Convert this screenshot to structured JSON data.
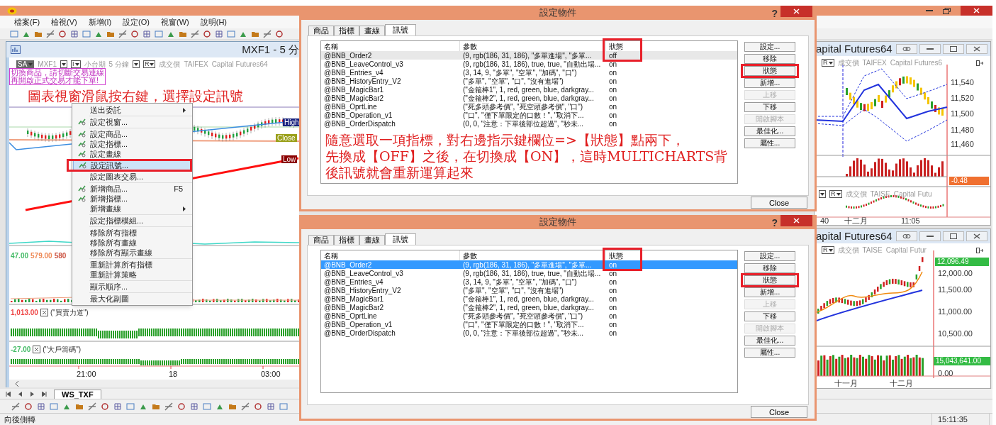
{
  "main_window": {
    "menu": [
      "檔案(F)",
      "檢視(V)",
      "新增(I)",
      "設定(O)",
      "視窗(W)",
      "說明(H)"
    ],
    "sheet_tab": "WS_TXF",
    "status_text": "向後側轉",
    "clock": "15:11:35"
  },
  "chart_window": {
    "title": "MXF1 - 5 分",
    "info": [
      {
        "kind": "badge",
        "text": "SA"
      },
      {
        "kind": "text",
        "text": "MXF1"
      },
      {
        "kind": "dropdown"
      },
      {
        "kind": "dropdown",
        "text": "I"
      },
      {
        "kind": "text",
        "text": "小台期"
      },
      {
        "kind": "text",
        "text": "5 分鐘"
      },
      {
        "kind": "dropdown"
      },
      {
        "kind": "dropdown",
        "text": "R"
      },
      {
        "kind": "text",
        "text": "成交價"
      },
      {
        "kind": "text",
        "text": "TAIFEX"
      },
      {
        "kind": "text",
        "text": "Capital Futures64"
      }
    ],
    "warning": [
      "切換商品，請切斷交易連線",
      "再開啟正式交易才能下單!"
    ],
    "annotation": "圖表視窗滑鼠按右鍵，選擇設定訊號",
    "price_tags": [
      {
        "label": "High",
        "color": "#1a237e"
      },
      {
        "label": "Close",
        "color": "#9aa01a"
      },
      {
        "label": "Low",
        "color": "#8b0000"
      }
    ],
    "panes": [
      {
        "values": [
          {
            "text": "47.00",
            "color": "#44bb66"
          },
          {
            "text": "579.00",
            "color": "#ee8855"
          },
          {
            "text": "580",
            "color": "#cc5544"
          }
        ]
      },
      {
        "values": [
          {
            "text": "1,013.00",
            "color": "#ee4444"
          }
        ],
        "name": "(\"買賣力道\")"
      },
      {
        "values": [
          {
            "text": "-27.00",
            "color": "#44bb66"
          }
        ],
        "name": "(\"大戶籌碼\")"
      }
    ],
    "time_labels": [
      "21:00",
      "18",
      "03:00"
    ]
  },
  "context_menu": {
    "groups": [
      [
        {
          "label": "送出委託",
          "submenu": true,
          "icon": false,
          "highlighted": false
        }
      ],
      [
        {
          "label": "設定視窗...",
          "submenu": false,
          "icon": true,
          "highlighted": false
        }
      ],
      [
        {
          "label": "設定商品...",
          "submenu": false,
          "icon": true,
          "highlighted": false
        },
        {
          "label": "設定指標...",
          "submenu": false,
          "icon": true,
          "highlighted": false
        },
        {
          "label": "設定畫線",
          "submenu": false,
          "icon": true,
          "highlighted": false
        },
        {
          "label": "設定訊號...",
          "submenu": false,
          "icon": true,
          "highlighted": true,
          "callout": true
        },
        {
          "label": "設定圖表交易...",
          "submenu": false,
          "icon": false,
          "highlighted": false
        }
      ],
      [
        {
          "label": "新增商品...",
          "shortcut": "F5",
          "submenu": false,
          "icon": true,
          "highlighted": false
        },
        {
          "label": "新增指標...",
          "submenu": false,
          "icon": true,
          "highlighted": false
        },
        {
          "label": "新增畫線",
          "submenu": true,
          "icon": false,
          "highlighted": false
        }
      ],
      [
        {
          "label": "設定指標模組...",
          "submenu": false,
          "icon": false,
          "highlighted": false
        }
      ],
      [
        {
          "label": "移除所有指標",
          "submenu": false,
          "icon": false,
          "highlighted": false
        },
        {
          "label": "移除所有畫線",
          "submenu": false,
          "icon": false,
          "highlighted": false
        },
        {
          "label": "移除所有顯示畫線",
          "submenu": false,
          "icon": false,
          "highlighted": false
        }
      ],
      [
        {
          "label": "重新計算所有指標",
          "submenu": false,
          "icon": false,
          "highlighted": false
        },
        {
          "label": "重新計算策略",
          "submenu": false,
          "icon": false,
          "highlighted": false
        }
      ],
      [
        {
          "label": "顯示順序...",
          "submenu": false,
          "icon": false,
          "highlighted": false
        }
      ],
      [
        {
          "label": "最大化副圖",
          "submenu": false,
          "icon": false,
          "highlighted": false
        }
      ]
    ]
  },
  "dialogs": [
    {
      "title": "設定物件",
      "help": "?",
      "list_focused": false,
      "tabs": [
        {
          "label": "商品",
          "selected": false
        },
        {
          "label": "指標",
          "selected": false
        },
        {
          "label": "畫線",
          "selected": false
        },
        {
          "label": "訊號",
          "selected": true
        }
      ],
      "columns": [
        {
          "label": "名稱"
        },
        {
          "label": "參數"
        },
        {
          "label": "狀態",
          "callout": true
        }
      ],
      "rows": [
        {
          "name": "@BNB_Order2",
          "params": "(9, rgb(186, 31, 186), \"多單進場\", \"多單...",
          "state": "off",
          "selected": true
        },
        {
          "name": "@BNB_LeaveControl_v3",
          "params": "(9, rgb(186, 31, 186), true, true, \"自動出場...",
          "state": "on",
          "selected": false
        },
        {
          "name": "@BNB_Entries_v4",
          "params": "(3, 14, 9, \"多單\", \"空單\", \"加碼\", \"口\")",
          "state": "on",
          "selected": false
        },
        {
          "name": "@BNB_HistoryEntry_V2",
          "params": "(\"多單\", \"空單\", \"口\", \"沒有進場\")",
          "state": "on",
          "selected": false
        },
        {
          "name": "@BNB_MagicBar1",
          "params": "(\"金箍棒1\", 1, red, green, blue, darkgray...",
          "state": "on",
          "selected": false
        },
        {
          "name": "@BNB_MagicBar2",
          "params": "(\"金箍棒2\", 1, red, green, blue, darkgray...",
          "state": "on",
          "selected": false
        },
        {
          "name": "@BNB_OprtLine",
          "params": "(\"死多頭參考價\", \"死空頭參考價\", \"口\")",
          "state": "on",
          "selected": false
        },
        {
          "name": "@BNB_Operation_v1",
          "params": "(\"口\", \"僅下單限定的口數！\", \"取消下...",
          "state": "on",
          "selected": false
        },
        {
          "name": "@BNB_OrderDispatch",
          "params": "(0, 0, \"注意：下單後部位超過\", \"秒未...",
          "state": "on",
          "selected": false
        }
      ],
      "note": [
        "隨意選取一項指標，對右邊指示鍵欄位=>【狀態】點兩下，",
        "先換成【OFF】之後，在切換成【ON】，這時MULTICHARTS背",
        "後訊號就會重新運算起來"
      ],
      "buttons": [
        {
          "label": "設定...",
          "disabled": false
        },
        {
          "label": "移除",
          "disabled": false
        },
        {
          "label": "狀態",
          "disabled": false,
          "callout": true
        },
        {
          "label": "新增...",
          "disabled": false
        },
        {
          "label": "上移",
          "disabled": true
        },
        {
          "label": "下移",
          "disabled": false
        },
        {
          "label": "開啟腳本",
          "disabled": true
        },
        {
          "label": "最佳化...",
          "disabled": false
        },
        {
          "label": "屬性...",
          "disabled": false
        }
      ],
      "close": "Close"
    },
    {
      "title": "設定物件",
      "help": "?",
      "list_focused": true,
      "tabs": [
        {
          "label": "商品",
          "selected": false
        },
        {
          "label": "指標",
          "selected": false
        },
        {
          "label": "畫線",
          "selected": false
        },
        {
          "label": "訊號",
          "selected": true
        }
      ],
      "columns": [
        {
          "label": "名稱"
        },
        {
          "label": "參數"
        },
        {
          "label": "狀態",
          "callout": true
        }
      ],
      "rows": [
        {
          "name": "@BNB_Order2",
          "params": "(9, rgb(186, 31, 186), \"多單進場\", \"多單...",
          "state": "on",
          "selected": true
        },
        {
          "name": "@BNB_LeaveControl_v3",
          "params": "(9, rgb(186, 31, 186), true, true, \"自動出場...",
          "state": "on",
          "selected": false
        },
        {
          "name": "@BNB_Entries_v4",
          "params": "(3, 14, 9, \"多單\", \"空單\", \"加碼\", \"口\")",
          "state": "on",
          "selected": false
        },
        {
          "name": "@BNB_HistoryEntry_V2",
          "params": "(\"多單\", \"空單\", \"口\", \"沒有進場\")",
          "state": "on",
          "selected": false
        },
        {
          "name": "@BNB_MagicBar1",
          "params": "(\"金箍棒1\", 1, red, green, blue, darkgray...",
          "state": "on",
          "selected": false
        },
        {
          "name": "@BNB_MagicBar2",
          "params": "(\"金箍棒2\", 1, red, green, blue, darkgray...",
          "state": "on",
          "selected": false
        },
        {
          "name": "@BNB_OprtLine",
          "params": "(\"死多頭參考價\", \"死空頭參考價\", \"口\")",
          "state": "on",
          "selected": false
        },
        {
          "name": "@BNB_Operation_v1",
          "params": "(\"口\", \"僅下單限定的口數！\", \"取消下...",
          "state": "on",
          "selected": false
        },
        {
          "name": "@BNB_OrderDispatch",
          "params": "(0, 0, \"注意：下單後部位超過\", \"秒未...",
          "state": "on",
          "selected": false
        }
      ],
      "buttons": [
        {
          "label": "設定...",
          "disabled": false
        },
        {
          "label": "移除",
          "disabled": false
        },
        {
          "label": "狀態",
          "disabled": false,
          "callout": true
        },
        {
          "label": "新增...",
          "disabled": false
        },
        {
          "label": "上移",
          "disabled": true
        },
        {
          "label": "下移",
          "disabled": false
        },
        {
          "label": "開啟腳本",
          "disabled": true
        },
        {
          "label": "最佳化...",
          "disabled": false
        },
        {
          "label": "屬性...",
          "disabled": false
        }
      ],
      "close": "Close"
    }
  ],
  "right_windows": [
    {
      "kind": "intraday",
      "title": "apital Futures64",
      "info": [
        {
          "kind": "dropdown",
          "text": "R"
        },
        {
          "kind": "text",
          "text": "成交價"
        },
        {
          "kind": "text",
          "text": "TAIFEX"
        },
        {
          "kind": "text",
          "text": "Capital Futures6"
        }
      ],
      "y_ticks": [
        "11,540",
        "11,520",
        "11,500",
        "11,480",
        "11,460"
      ],
      "tag": {
        "text": "-0.48",
        "color": "#f07030"
      },
      "info2": [
        {
          "kind": "dropdown"
        },
        {
          "kind": "dropdown",
          "text": "R"
        },
        {
          "kind": "text",
          "text": "成交價"
        },
        {
          "kind": "text",
          "text": "TAISE"
        },
        {
          "kind": "text",
          "text": "Capital Futu"
        }
      ],
      "x_labels": [
        "40",
        "十二月",
        "11:05"
      ]
    },
    {
      "kind": "daily",
      "title": "apital Futures64",
      "info": [
        {
          "kind": "dropdown",
          "text": "R"
        },
        {
          "kind": "text",
          "text": "成交價"
        },
        {
          "kind": "text",
          "text": "TAISE"
        },
        {
          "kind": "text",
          "text": "Capital Futur"
        }
      ],
      "tag": {
        "text": "12,096.49",
        "color": "#33bb44"
      },
      "y_ticks": [
        "12,000.00",
        "11,500.00",
        "11,000.00",
        "10,500.00"
      ],
      "tag2": {
        "text": "15,043,641.00",
        "color": "#33bb44"
      },
      "zero": "0.00",
      "x_labels": [
        "十一月",
        "十二月"
      ]
    }
  ]
}
